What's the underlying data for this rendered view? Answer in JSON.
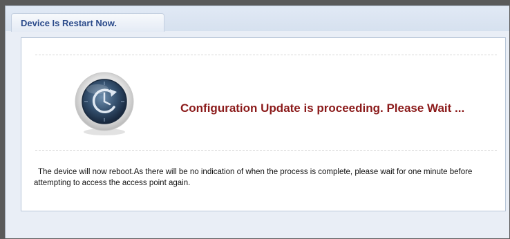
{
  "dialog": {
    "title": "Device Is Restart Now.",
    "status_message": "Configuration Update is proceeding. Please Wait ...",
    "note": "The device will now reboot.As there will be no indication of when the process is complete, please wait for one minute before attempting to access the access point again.",
    "icon": "restart-clock-icon"
  },
  "colors": {
    "title": "#2a4a8a",
    "status_message": "#8b1a1a"
  }
}
